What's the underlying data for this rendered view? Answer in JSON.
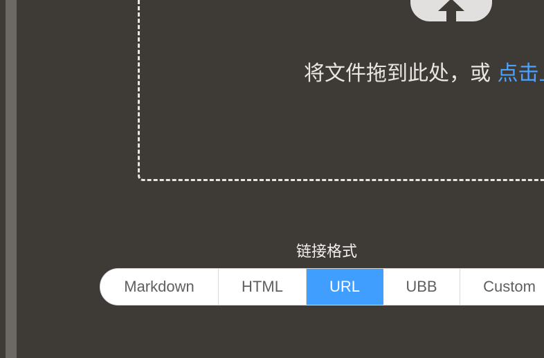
{
  "upload": {
    "icon": "cloud-upload-icon",
    "prompt_text": "将文件拖到此处，或 ",
    "click_text": "点击上传",
    "link_color": "#4aa3ff"
  },
  "link_format": {
    "label": "链接格式",
    "selected": "URL",
    "accent_color": "#409eff",
    "options": [
      "Markdown",
      "HTML",
      "URL",
      "UBB",
      "Custom"
    ]
  }
}
